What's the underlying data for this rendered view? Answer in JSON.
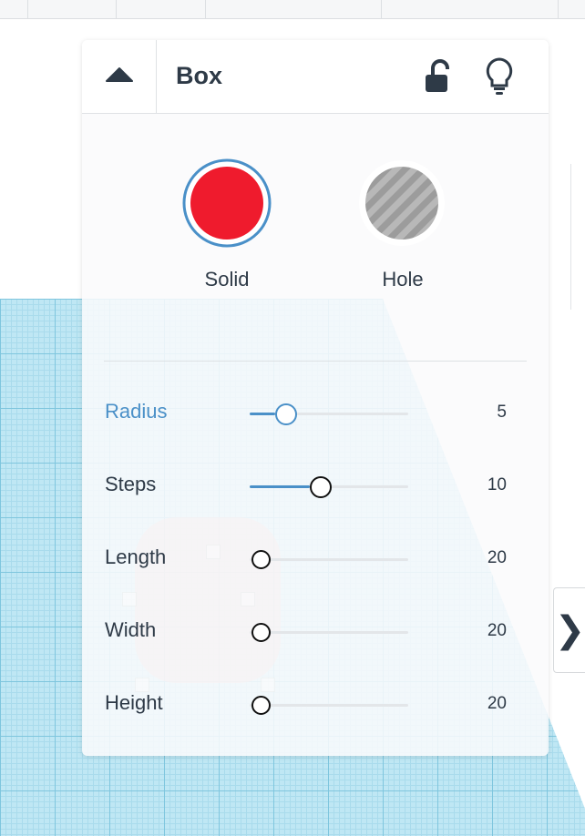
{
  "panel": {
    "title": "Box",
    "icons": {
      "collapse": "caret-up-icon",
      "lock": "unlock-icon",
      "bulb": "lightbulb-icon"
    },
    "swatches": {
      "solid": {
        "label": "Solid",
        "color": "#ef1b2d",
        "selected": true
      },
      "hole": {
        "label": "Hole",
        "selected": false
      }
    },
    "properties": [
      {
        "label": "Radius",
        "value": "5",
        "fraction": 0.24,
        "active": true
      },
      {
        "label": "Steps",
        "value": "10",
        "fraction": 0.45,
        "active": false
      },
      {
        "label": "Length",
        "value": "20",
        "fraction": 0.0,
        "active": false
      },
      {
        "label": "Width",
        "value": "20",
        "fraction": 0.0,
        "active": false
      },
      {
        "label": "Height",
        "value": "20",
        "fraction": 0.0,
        "active": false
      }
    ]
  },
  "next_tab": {
    "glyph": "❯",
    "icon": "chevron-right-icon"
  },
  "colors": {
    "accent": "#4a90c8",
    "grid": "#bfe7f4",
    "solid": "#ef1b2d"
  }
}
